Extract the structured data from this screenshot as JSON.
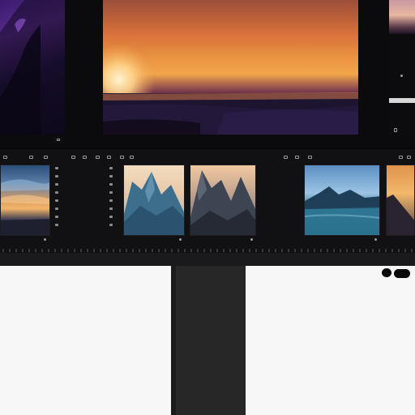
{
  "viewer": {
    "preview_caption": "",
    "bottom_right_label": "",
    "left_panel_label": ""
  },
  "filmstrip": {
    "thumbnails": [
      {
        "name": "sunset-sky",
        "label": ""
      },
      {
        "name": "blue-mountains",
        "label": ""
      },
      {
        "name": "dark-mountains",
        "label": ""
      },
      {
        "name": "mountain-lake",
        "label": ""
      },
      {
        "name": "orange-cliff",
        "label": ""
      }
    ]
  },
  "icons": {
    "toolbar": [
      "grid-icon",
      "list-icon",
      "folder-icon",
      "share-icon",
      "settings-icon"
    ],
    "side_controls": [
      "chevron-icon",
      "menu-icon"
    ]
  },
  "colors": {
    "frame": "#070707",
    "strip_background": "#111113",
    "stand": "#272727",
    "wall": "#f7f7f7",
    "sunset_orange": "#e88a3a",
    "sunset_purple": "#3b1f5f"
  }
}
